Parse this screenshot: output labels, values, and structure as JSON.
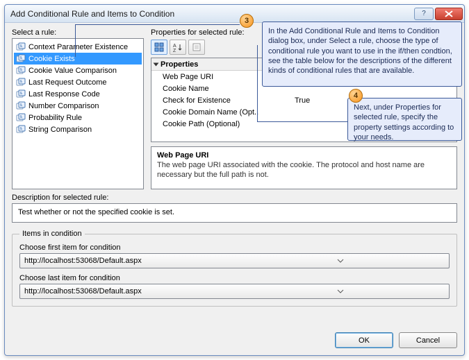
{
  "title": "Add Conditional Rule and Items to Condition",
  "labels": {
    "select_rule": "Select a rule:",
    "properties_for_rule": "Properties for selected rule:",
    "description_for_rule": "Description for selected rule:",
    "items_in_condition": "Items in condition",
    "choose_first": "Choose first item for condition",
    "choose_last": "Choose last item for condition"
  },
  "rules": [
    "Context Parameter Existence",
    "Cookie Exists",
    "Cookie Value Comparison",
    "Last Request Outcome",
    "Last Response Code",
    "Number Comparison",
    "Probability Rule",
    "String Comparison"
  ],
  "selected_rule_index": 1,
  "properties": {
    "group_label": "Properties",
    "rows": [
      {
        "name": "Web Page URI",
        "value": ""
      },
      {
        "name": "Cookie Name",
        "value": ""
      },
      {
        "name": "Check for Existence",
        "value": "True"
      },
      {
        "name": "Cookie Domain Name (Opt..",
        "value": ""
      },
      {
        "name": "Cookie Path (Optional)",
        "value": ""
      }
    ],
    "desc_title": "Web Page URI",
    "desc_body": "The web page URI associated with the cookie. The protocol and host name are necessary but the full path is not."
  },
  "description": "Test whether or not the specified cookie is set.",
  "combo_first": "http://localhost:53068/Default.aspx",
  "combo_last": "http://localhost:53068/Default.aspx",
  "buttons": {
    "ok": "OK",
    "cancel": "Cancel"
  },
  "callouts": {
    "n3": "3",
    "t3": "In the Add Conditional Rule and Items to Condition dialog box, under Select a rule, choose the type of conditional rule you want to use in the if/then condtion, see the table below for the descriptions of the different kinds of conditional rules that are available.",
    "n4": "4",
    "t4": "Next, under Properties for selected rule, specify the property settings according to your needs."
  }
}
